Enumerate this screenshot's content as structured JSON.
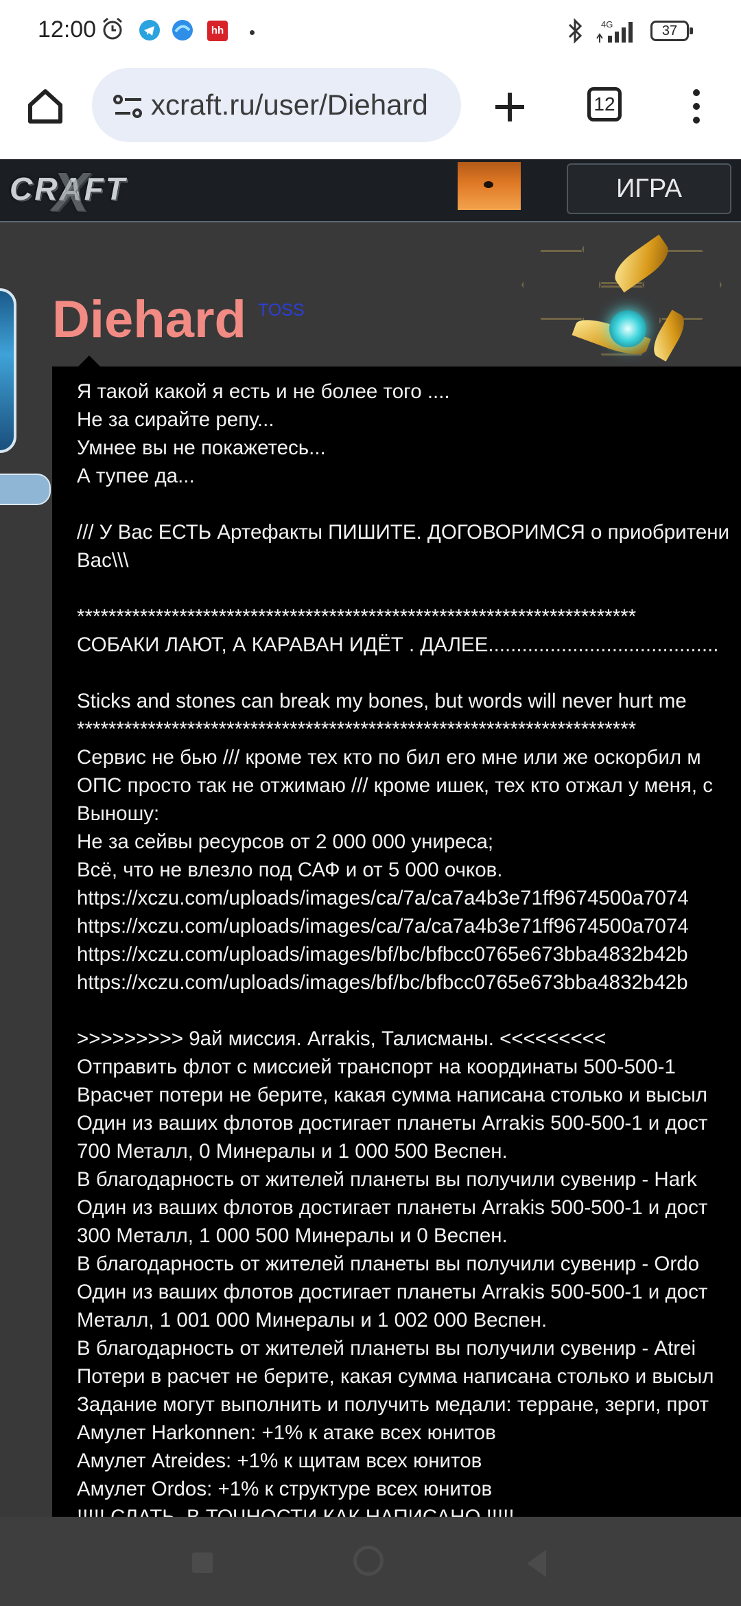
{
  "status_bar": {
    "time": "12:00",
    "battery": "37",
    "network": "4G",
    "icons": [
      "alarm-icon",
      "telegram-icon",
      "browser-app-icon",
      "hh-icon",
      "dot-icon",
      "bluetooth-icon",
      "signal-icon",
      "battery-icon"
    ],
    "hh_label": "hh"
  },
  "browser": {
    "url": "xcraft.ru/user/Diehard",
    "tab_count": "12",
    "icons": [
      "home-icon",
      "site-settings-icon",
      "new-tab-icon",
      "tabs-icon",
      "menu-icon"
    ]
  },
  "site_header": {
    "logo": "CRAFT",
    "game_button": "ИГРА"
  },
  "profile": {
    "username": "Diehard",
    "race": "TOSS",
    "bio_lines": [
      "Я такой какой я есть и не более того ....",
      "Не за сирайте репу...",
      "Умнее вы не покажетесь...",
      "А тупее да...",
      "",
      "/// У Вас ЕСТЬ Артефакты ПИШИТЕ. ДОГОВОРИМСЯ о приобритени",
      "Вас\\\\\\",
      "",
      "***********************************************************************",
      "СОБАКИ ЛАЮТ, А КАРАВАН ИДЁТ . ДАЛЕЕ.........................................",
      "",
      "Sticks and stones can break my bones, but words will never hurt me",
      "***********************************************************************",
      "Сервис не бью /// кроме тех кто по бил его мне или же оскорбил м",
      "ОПС просто так не отжимаю /// кроме ишек, тех кто отжал у меня, с",
      "Выношу:",
      "Не за сейвы ресурсов от 2 000 000 унирeса;",
      "Всё, что не влезло под САФ и от 5 000 очков.",
      "https://xczu.com/uploads/images/ca/7a/ca7a4b3e71ff9674500a7074",
      "https://xczu.com/uploads/images/ca/7a/ca7a4b3e71ff9674500a7074",
      "https://xczu.com/uploads/images/bf/bc/bfbcc0765e673bba4832b42b",
      "https://xczu.com/uploads/images/bf/bc/bfbcc0765e673bba4832b42b",
      "",
      ">>>>>>>>> 9ай миссия. Arrakis, Талисманы. <<<<<<<<<",
      "Отправить флот с миссией транспорт на координаты 500-500-1",
      "Врасчет потери не берите, какая сумма написана столько и высыл",
      "Один из ваших флотов достигает планеты Arrakis 500-500-1 и дост",
      "700 Металл, 0 Минералы и 1 000 500 Веспен.",
      "В благодарность от жителей планеты вы получили сувенир - Hark",
      "Один из ваших флотов достигает планеты Arrakis 500-500-1 и дост",
      "300 Металл, 1 000 500 Минералы и 0 Веспен.",
      "В благодарность от жителей планеты вы получили сувенир - Ordo",
      "Один из ваших флотов достигает планеты Arrakis 500-500-1 и дост",
      "Металл, 1 001 000 Минералы и 1 002 000 Веспен.",
      "В благодарность от жителей планеты вы получили сувенир - Atrei",
      "Потери в расчет не берите, какая сумма написана столько и высыл",
      "Задание могут выполнить и получить медали: терране, зерги, прот",
      "Амулет Harkonnen: +1% к атаке всех юнитов",
      "Амулет Atreides: +1% к щитам всех юнитов",
      "Амулет Ordos: +1% к структуре всех юнитов",
      "!!!!! СЛАТЬ  В ТОЧНОСТИ КАК НАПИСАНО !!!!!"
    ]
  },
  "nav_bar": {
    "icons": [
      "recents-icon",
      "home-nav-icon",
      "back-icon"
    ]
  }
}
